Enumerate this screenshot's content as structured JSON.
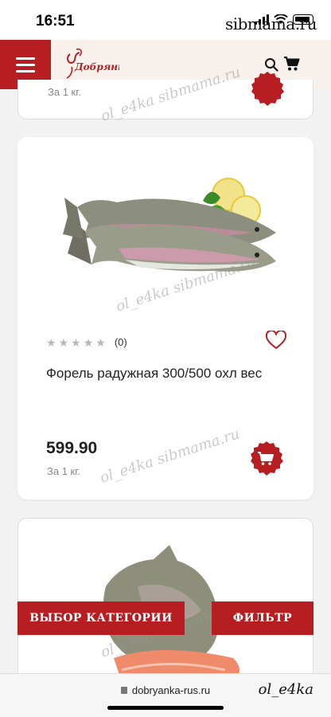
{
  "status": {
    "time": "16:51",
    "watermark": "sibmama.ru"
  },
  "header": {
    "logo_text": "Добрянка",
    "menu_icon": "hamburger-icon",
    "search_icon": "search-icon",
    "cart_icon": "cart-icon",
    "brand_color": "#b71e22"
  },
  "products": [
    {
      "per_unit": "За 1 кг."
    },
    {
      "name": "Форель радужная 300/500 охл вес",
      "rating_count": "(0)",
      "price": "599.90",
      "per_unit": "За 1 кг."
    }
  ],
  "watermark": "ol_e4ka sibmama.ru",
  "buttons": {
    "category": "ВЫБОР КАТЕГОРИИ",
    "filter": "ФИЛЬТР"
  },
  "url_bar": {
    "url": "dobryanka-rus.ru"
  },
  "bottom_watermark": "ol_e4ka"
}
